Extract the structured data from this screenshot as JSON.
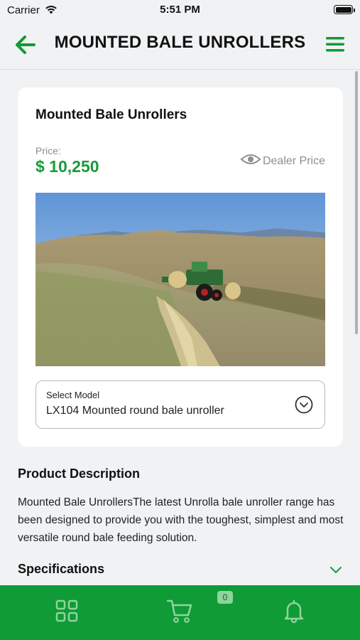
{
  "status_bar": {
    "carrier": "Carrier",
    "time": "5:51 PM"
  },
  "header": {
    "title": "MOUNTED BALE UNROLLERS"
  },
  "product": {
    "name": "Mounted Bale Unrollers",
    "price_label": "Price:",
    "price": "$ 10,250",
    "dealer_price_label": "Dealer Price"
  },
  "model_select": {
    "label": "Select Model",
    "value": "LX104 Mounted round bale unroller"
  },
  "description": {
    "title": "Product Description",
    "text": "Mounted Bale UnrollersThe latest Unrolla bale unroller range has been designed to provide you with the toughest, simplest and most versatile round bale feeding solution."
  },
  "specifications": {
    "title": "Specifications"
  },
  "tabbar": {
    "cart_count": "0"
  },
  "colors": {
    "brand_green": "#0f9b36",
    "price_green": "#1a9a3a",
    "background": "#f0f2f4"
  },
  "icons": [
    "wifi-icon",
    "battery-icon",
    "back-arrow-icon",
    "menu-icon",
    "eye-icon",
    "chevron-circle-icon",
    "chevron-down-icon",
    "grid-icon",
    "cart-icon",
    "bell-icon"
  ]
}
